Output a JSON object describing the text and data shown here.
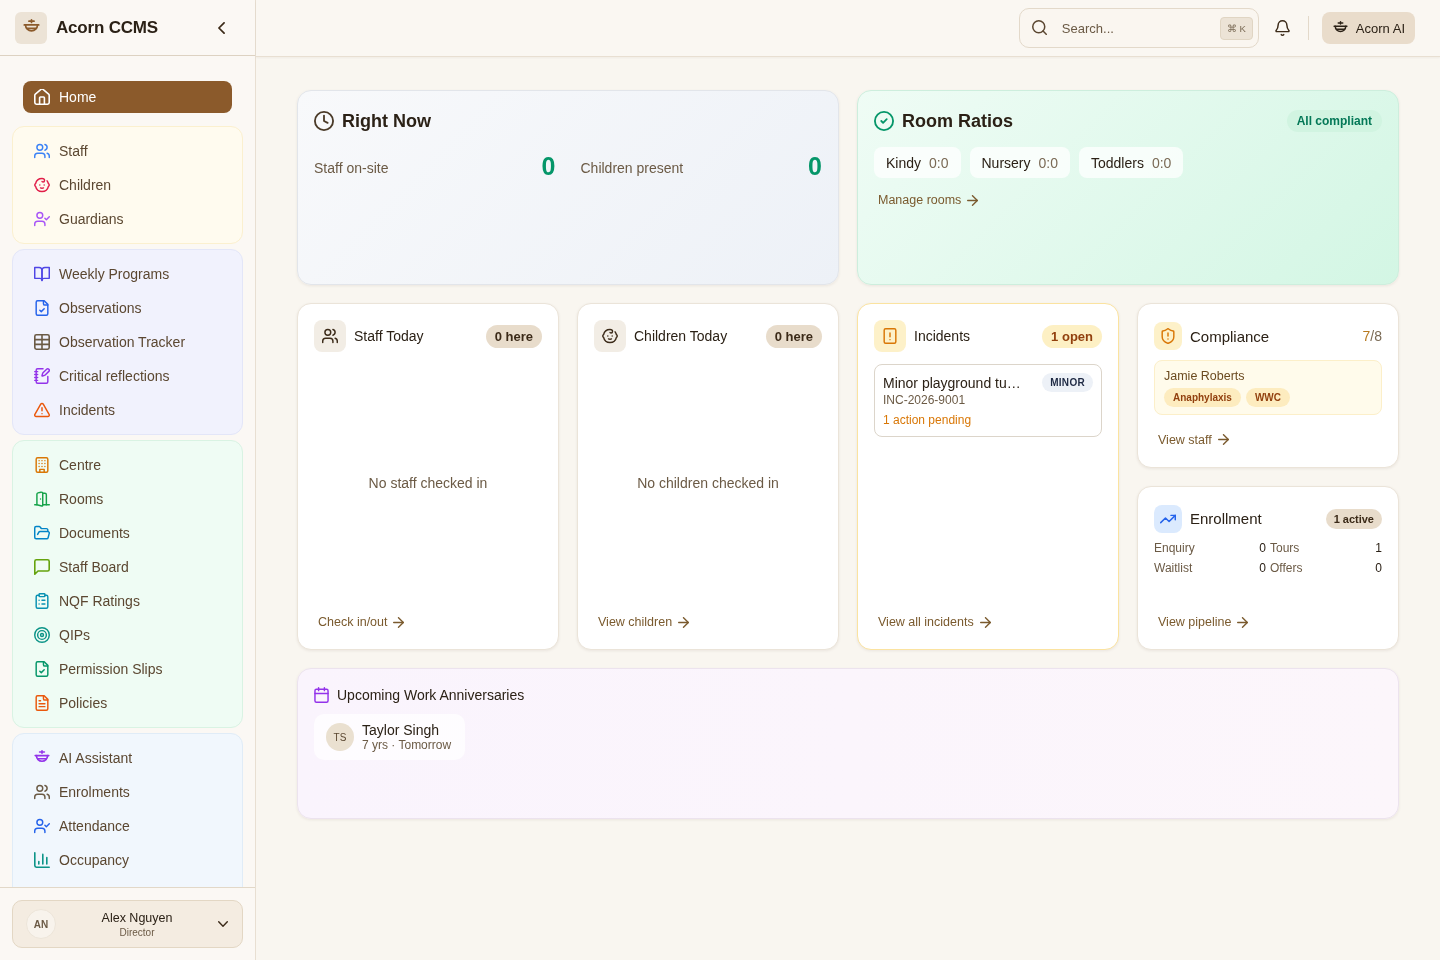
{
  "sidebar": {
    "brand": "Acorn CCMS",
    "nav": {
      "home": {
        "label": "Home",
        "selected": true
      },
      "groups": [
        {
          "items": [
            {
              "label": "Staff",
              "selected": false
            },
            {
              "label": "Children",
              "selected": false
            },
            {
              "label": "Guardians",
              "selected": false
            }
          ]
        },
        {
          "items": [
            {
              "label": "Weekly Programs",
              "selected": false
            },
            {
              "label": "Observations",
              "selected": false
            },
            {
              "label": "Observation Tracker",
              "selected": false
            },
            {
              "label": "Critical reflections",
              "selected": false
            },
            {
              "label": "Incidents",
              "selected": false
            }
          ]
        },
        {
          "items": [
            {
              "label": "Centre",
              "selected": false
            },
            {
              "label": "Rooms",
              "selected": false
            },
            {
              "label": "Documents",
              "selected": false
            },
            {
              "label": "Staff Board",
              "selected": false
            },
            {
              "label": "NQF Ratings",
              "selected": false
            },
            {
              "label": "QIPs",
              "selected": false
            },
            {
              "label": "Permission Slips",
              "selected": false
            },
            {
              "label": "Policies",
              "selected": false
            }
          ]
        },
        {
          "items": [
            {
              "label": "AI Assistant",
              "selected": false
            },
            {
              "label": "Enrolments",
              "selected": false
            },
            {
              "label": "Attendance",
              "selected": false
            },
            {
              "label": "Occupancy",
              "selected": false
            }
          ]
        }
      ]
    },
    "user": {
      "initials": "AN",
      "name": "Alex Nguyen",
      "role": "Director"
    }
  },
  "topbar": {
    "search": {
      "placeholder": "Search...",
      "shortcut": "⌘ K"
    },
    "ai_button": "Acorn AI"
  },
  "right_now": {
    "title": "Right Now",
    "stats": [
      {
        "label": "Staff on-site",
        "value": "0"
      },
      {
        "label": "Children present",
        "value": "0"
      }
    ]
  },
  "room_ratios": {
    "title": "Room Ratios",
    "badge": "All compliant",
    "rooms": [
      {
        "name": "Kindy",
        "ratio": "0:0"
      },
      {
        "name": "Nursery",
        "ratio": "0:0"
      },
      {
        "name": "Toddlers",
        "ratio": "0:0"
      }
    ],
    "link": "Manage rooms"
  },
  "today_cards": [
    {
      "title": "Staff Today",
      "badge": "0 here",
      "empty": "No staff checked in",
      "link": "Check in/out"
    },
    {
      "title": "Children Today",
      "badge": "0 here",
      "empty": "No children checked in",
      "link": "View children"
    }
  ],
  "incidents": {
    "title": "Incidents",
    "badge": "1 open",
    "items": [
      {
        "title": "Minor playground tu…",
        "severity": "MINOR",
        "reference": "INC-2026-9001",
        "note": "1 action pending"
      }
    ],
    "link": "View all incidents"
  },
  "compliance": {
    "title": "Compliance",
    "score": {
      "value": "7",
      "out_of": "/8"
    },
    "people": [
      {
        "name": "Jamie Roberts",
        "tags": [
          "Anaphylaxis",
          "WWC"
        ]
      }
    ],
    "link": "View staff"
  },
  "enrollment": {
    "title": "Enrollment",
    "badge": "1 active",
    "stats": [
      {
        "label": "Enquiry",
        "value": "0"
      },
      {
        "label": "Tours",
        "value": "1"
      },
      {
        "label": "Waitlist",
        "value": "0"
      },
      {
        "label": "Offers",
        "value": "0"
      }
    ],
    "link": "View pipeline"
  },
  "anniversaries": {
    "title": "Upcoming Work Anniversaries",
    "people": [
      {
        "initials": "TS",
        "name": "Taylor Singh",
        "detail": "7 yrs · Tomorrow"
      }
    ]
  }
}
